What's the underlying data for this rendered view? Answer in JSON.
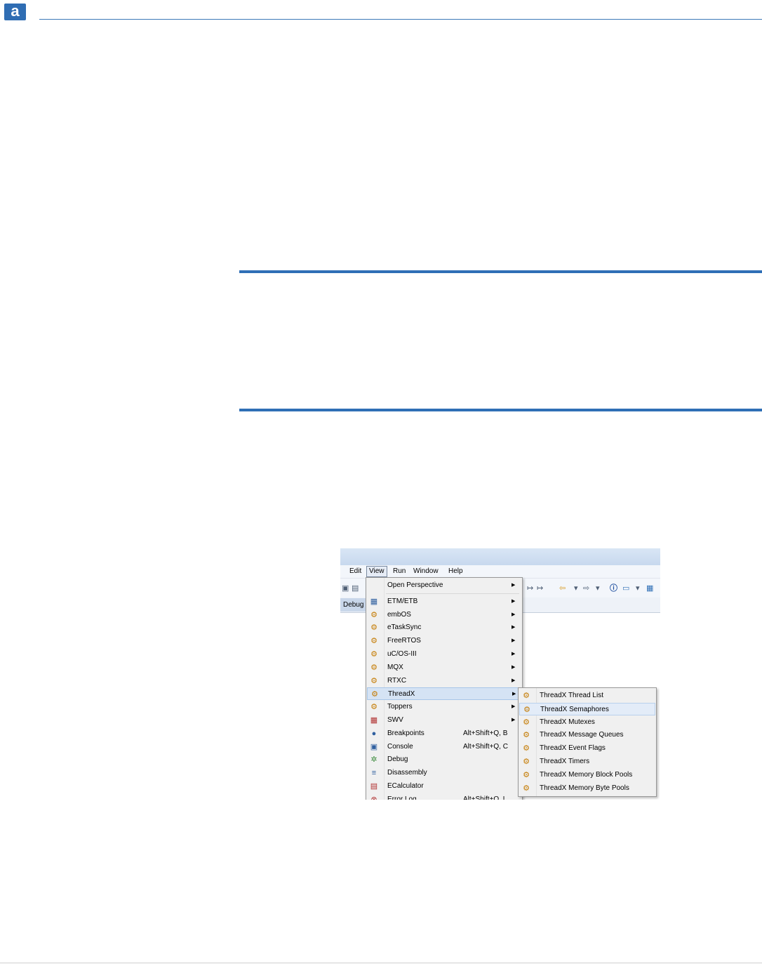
{
  "logo": {
    "letter": "a"
  },
  "screenshot": {
    "menubar": {
      "edit": "Edit",
      "view": "View",
      "run": "Run",
      "window": "Window",
      "help": "Help"
    },
    "tab": {
      "debug": "Debug"
    },
    "toolbar_icons": [
      "save-icon",
      "redo-icon",
      "back-arrow-icon",
      "forward-arrow-icon",
      "info-icon",
      "window-icon",
      "table-icon"
    ],
    "view_menu": [
      {
        "label": "Open Perspective",
        "shortcut": "",
        "submenu": true,
        "icon": ""
      },
      {
        "label": "ETM/ETB",
        "shortcut": "",
        "submenu": true,
        "icon": "table-icon"
      },
      {
        "label": "embOS",
        "shortcut": "",
        "submenu": true,
        "icon": "gears-icon"
      },
      {
        "label": "eTaskSync",
        "shortcut": "",
        "submenu": true,
        "icon": "gears-icon"
      },
      {
        "label": "FreeRTOS",
        "shortcut": "",
        "submenu": true,
        "icon": "gears-icon"
      },
      {
        "label": "uC/OS-III",
        "shortcut": "",
        "submenu": true,
        "icon": "gears-icon"
      },
      {
        "label": "MQX",
        "shortcut": "",
        "submenu": true,
        "icon": "gears-icon"
      },
      {
        "label": "RTXC",
        "shortcut": "",
        "submenu": true,
        "icon": "gears-icon"
      },
      {
        "label": "ThreadX",
        "shortcut": "",
        "submenu": true,
        "icon": "gears-icon"
      },
      {
        "label": "Toppers",
        "shortcut": "",
        "submenu": true,
        "icon": "gears-icon"
      },
      {
        "label": "SWV",
        "shortcut": "",
        "submenu": true,
        "icon": "grid-icon"
      },
      {
        "label": "Breakpoints",
        "shortcut": "Alt+Shift+Q, B",
        "submenu": false,
        "icon": "breakpoints-icon"
      },
      {
        "label": "Console",
        "shortcut": "Alt+Shift+Q, C",
        "submenu": false,
        "icon": "console-icon"
      },
      {
        "label": "Debug",
        "shortcut": "",
        "submenu": false,
        "icon": "bug-icon"
      },
      {
        "label": "Disassembly",
        "shortcut": "",
        "submenu": false,
        "icon": "disassembly-icon"
      },
      {
        "label": "ECalculator",
        "shortcut": "",
        "submenu": false,
        "icon": "calculator-icon"
      },
      {
        "label": "Error Log",
        "shortcut": "Alt+Shift+Q, L",
        "submenu": false,
        "icon": "error-icon"
      }
    ],
    "threadx_submenu": [
      "ThreadX Thread List",
      "ThreadX Semaphores",
      "ThreadX Mutexes",
      "ThreadX Message Queues",
      "ThreadX Event Flags",
      "ThreadX Timers",
      "ThreadX Memory Block Pools",
      "ThreadX Memory Byte Pools"
    ],
    "highlighted_view_item": "ThreadX",
    "highlighted_sub_item": "ThreadX Semaphores",
    "colors": {
      "accent": "#2f6fb6",
      "menu_bg": "#f0f0f0",
      "highlight": "#d5e3f4"
    }
  }
}
